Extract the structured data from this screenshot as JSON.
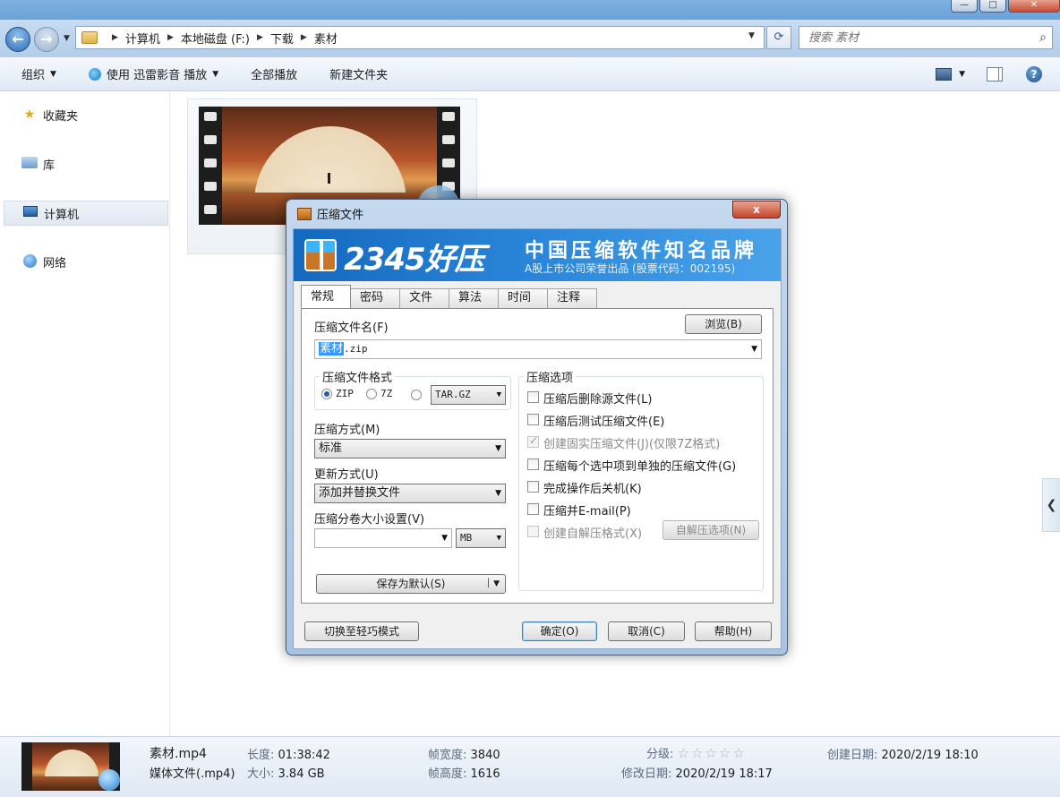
{
  "window": {
    "controls": {
      "min": "—",
      "max": "□",
      "close": "✕"
    }
  },
  "address": {
    "crumbs": [
      "计算机",
      "本地磁盘 (F:)",
      "下载",
      "素材"
    ],
    "search_placeholder": "搜索 素材"
  },
  "toolbar": {
    "organize": "组织",
    "play_with": "使用 迅雷影音 播放",
    "play_all": "全部播放",
    "new_folder": "新建文件夹",
    "help": "?"
  },
  "nav": {
    "favorites": "收藏夹",
    "libraries": "库",
    "computer": "计算机",
    "network": "网络"
  },
  "details": {
    "name": "素材.mp4",
    "type": "媒体文件(.mp4)",
    "length_label": "长度:",
    "length": "01:38:42",
    "size_label": "大小:",
    "size": "3.84 GB",
    "width_label": "帧宽度:",
    "width": "3840",
    "height_label": "帧高度:",
    "height": "1616",
    "rating_label": "分级:",
    "rating_stars": "☆☆☆☆☆",
    "rating": 0,
    "modified_label": "修改日期:",
    "modified": "2020/2/19 18:17",
    "created_label": "创建日期:",
    "created": "2020/2/19 18:10"
  },
  "dialog": {
    "title": "压缩文件",
    "close": "x",
    "brand": "2345好压",
    "slogan": "中国压缩软件知名品牌",
    "subslogan": "A股上市公司荣誉出品 (股票代码：002195)",
    "tabs": [
      "常规",
      "密码",
      "文件",
      "算法",
      "时间",
      "注释"
    ],
    "filename_label": "压缩文件名(F)",
    "browse_button": "浏览(B)",
    "filename_selected": "素材",
    "filename_rest": ".zip",
    "format_group": "压缩文件格式",
    "format_zip": "ZIP",
    "format_7z": "7Z",
    "format_targz": "TAR.GZ",
    "method_label": "压缩方式(M)",
    "method_value": "标准",
    "update_label": "更新方式(U)",
    "update_value": "添加并替换文件",
    "split_label": "压缩分卷大小设置(V)",
    "split_value": "",
    "split_unit": "MB",
    "save_default_button": "保存为默认(S)",
    "options_group": "压缩选项",
    "options": [
      "压缩后删除源文件(L)",
      "压缩后测试压缩文件(E)",
      "创建固实压缩文件(J)(仅限7Z格式)",
      "压缩每个选中项到单独的压缩文件(G)",
      "完成操作后关机(K)",
      "压缩并E-mail(P)",
      "创建自解压格式(X)"
    ],
    "sfx_options_button": "自解压选项(N)",
    "light_mode_button": "切换至轻巧模式",
    "ok_button": "确定(O)",
    "cancel_button": "取消(C)",
    "help_button": "帮助(H)"
  }
}
